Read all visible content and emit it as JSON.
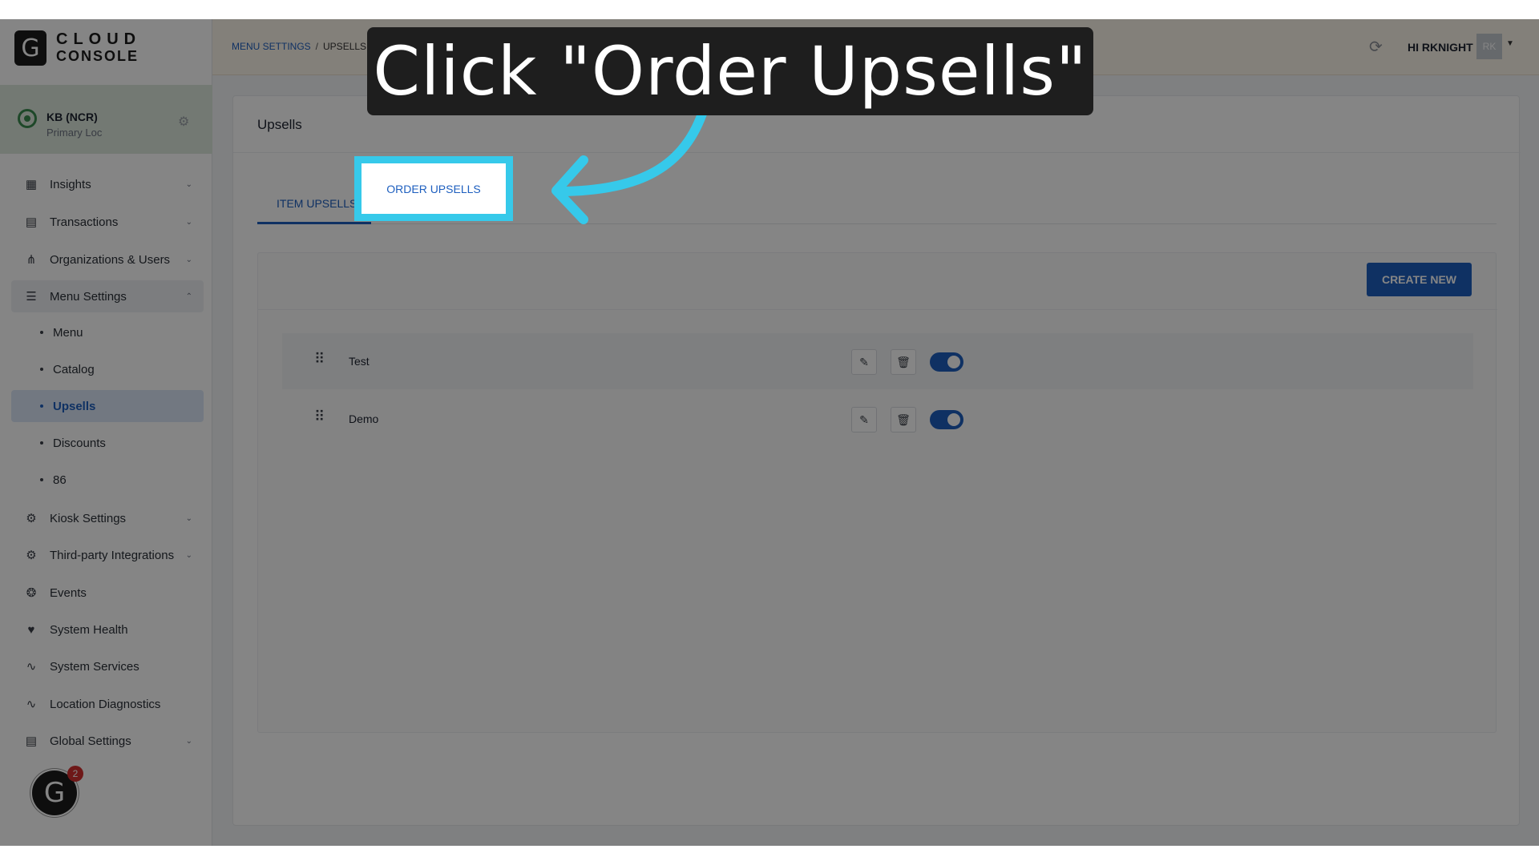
{
  "logo": {
    "mark": "G",
    "line1": "CLOUD",
    "line2": "CONSOLE"
  },
  "location": {
    "name": "KB (NCR)",
    "subtitle": "Primary Loc"
  },
  "sidebar": {
    "items": [
      {
        "label": "Insights",
        "icon": "chart-icon"
      },
      {
        "label": "Transactions",
        "icon": "receipt-icon"
      },
      {
        "label": "Organizations & Users",
        "icon": "org-icon"
      },
      {
        "label": "Menu Settings",
        "icon": "menu-icon"
      },
      {
        "label": "Kiosk Settings",
        "icon": "gear-icon"
      },
      {
        "label": "Third-party Integrations",
        "icon": "gear-icon"
      },
      {
        "label": "Events",
        "icon": "events-icon"
      },
      {
        "label": "System Health",
        "icon": "heart-icon"
      },
      {
        "label": "System Services",
        "icon": "pulse-icon"
      },
      {
        "label": "Location Diagnostics",
        "icon": "pulse-icon"
      },
      {
        "label": "Global Settings",
        "icon": "doc-icon"
      }
    ],
    "submenu": [
      "Menu",
      "Catalog",
      "Upsells",
      "Discounts",
      "86"
    ]
  },
  "badge": {
    "mark": "G",
    "count": "2"
  },
  "header": {
    "breadcrumb_parent": "MENU SETTINGS",
    "breadcrumb_sep": "/",
    "breadcrumb_current": "UPSELLS",
    "greeting": "HI RKNIGHT",
    "avatar": "RK"
  },
  "main": {
    "title": "Upsells",
    "tabs": [
      "ITEM UPSELLS",
      "ORDER UPSELLS"
    ],
    "create_label": "CREATE NEW",
    "rows": [
      {
        "name": "Test",
        "enabled": true
      },
      {
        "name": "Demo",
        "enabled": true
      }
    ]
  },
  "callout": {
    "text": "Click \"Order Upsells\""
  },
  "colors": {
    "accent": "#1e5fbf",
    "highlight": "#36c9ea",
    "callout_bg": "#1e1e1e"
  }
}
